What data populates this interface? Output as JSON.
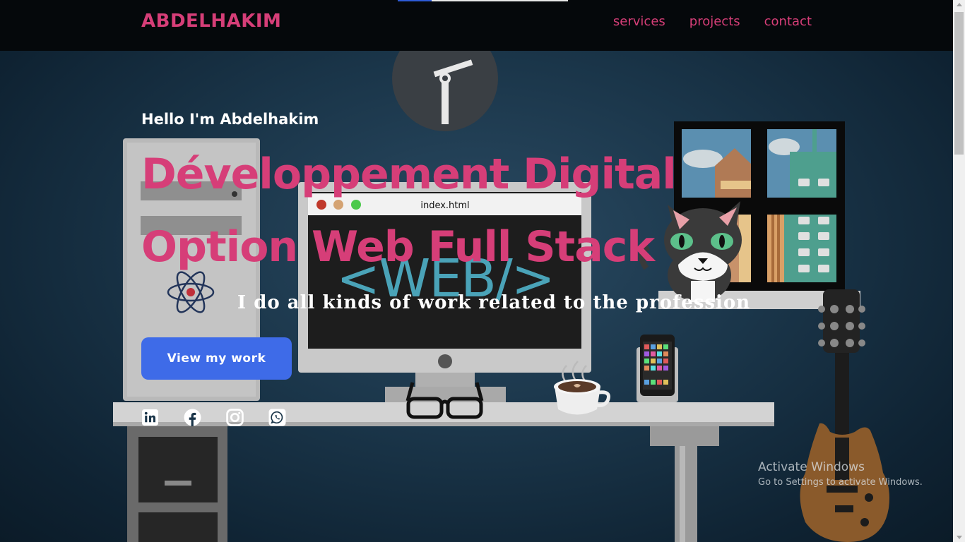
{
  "nav": {
    "brand": "ABDELHAKIM",
    "links": [
      "services",
      "projects",
      "contact"
    ],
    "scroll_progress_fraction": 0.2
  },
  "hero": {
    "greeting": "Hello I'm Abdelhakim",
    "title_line_1": "Développement Digital",
    "title_line_2": "Option Web Full Stack",
    "tagline": "I do all kinds of work related to the profession",
    "cta_label": "View my work"
  },
  "socials": [
    "linkedin-icon",
    "facebook-icon",
    "instagram-icon",
    "whatsapp-icon"
  ],
  "illustration": {
    "monitor_window_title": "index.html",
    "monitor_code_text": "<WEB/>"
  },
  "windows_watermark": {
    "title": "Activate Windows",
    "subtitle": "Go to Settings to activate Windows."
  },
  "colors": {
    "accent": "#d63e78",
    "button": "#3e6be8",
    "navbar": "#05080b"
  }
}
